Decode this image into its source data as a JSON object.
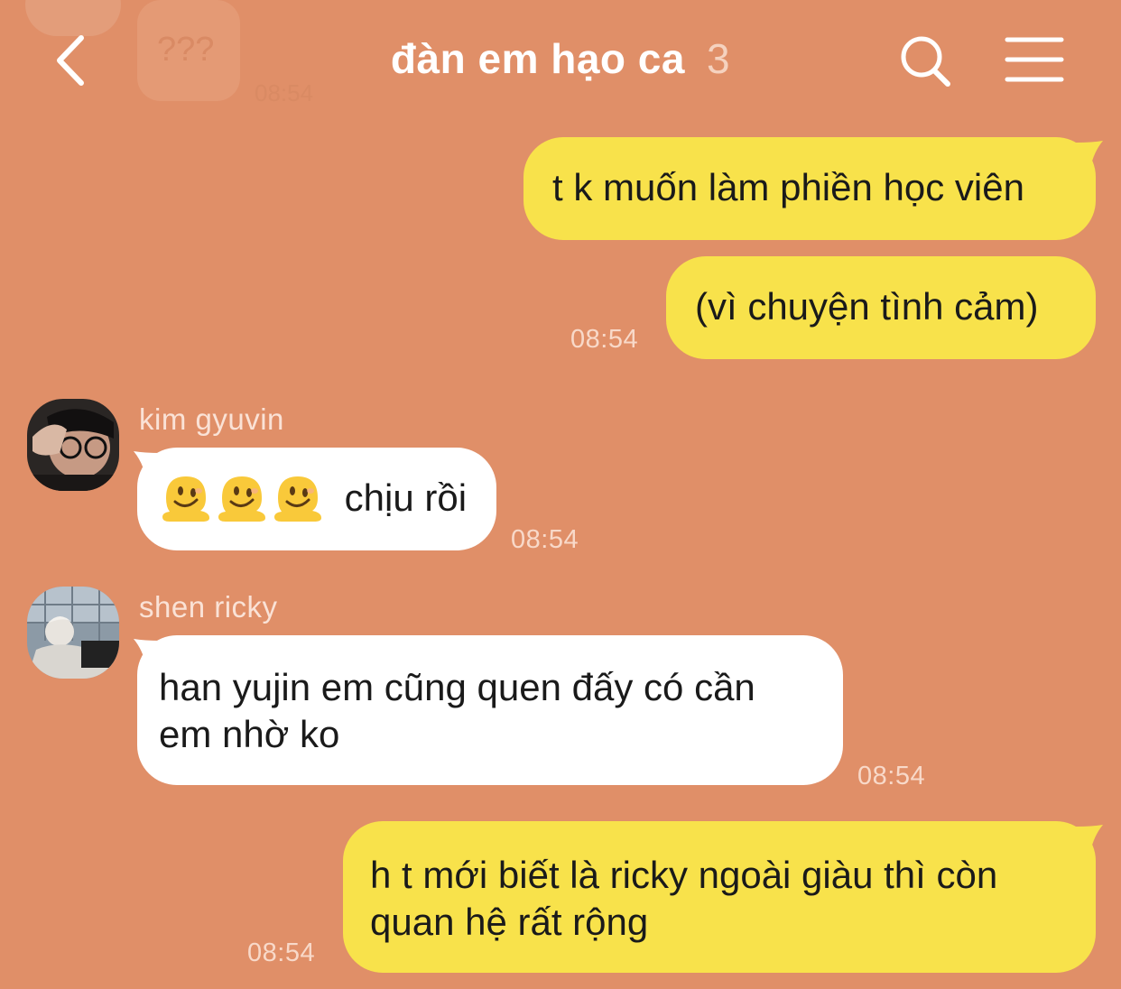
{
  "header": {
    "title": "đàn em hạo ca",
    "member_count": "3",
    "ghost_bubble_text": "???",
    "ghost_time": "08:54"
  },
  "icons": {
    "back": "chevron-left-icon",
    "search": "search-icon",
    "menu": "hamburger-menu-icon",
    "emoji": "melting-face-emoji"
  },
  "colors": {
    "background": "#e08f68",
    "my_bubble": "#f8e24b",
    "their_bubble": "#ffffff"
  },
  "messages": [
    {
      "id": "m1",
      "sender": "me",
      "text": "t k muốn làm phiền học viên"
    },
    {
      "id": "m2",
      "sender": "me",
      "text": "(vì chuyện tình cảm)",
      "time": "08:54"
    },
    {
      "id": "m3",
      "sender": "kim gyuvin",
      "emoji_count": 3,
      "text": "chịu rồi",
      "time": "08:54"
    },
    {
      "id": "m4",
      "sender": "shen ricky",
      "text_lines": [
        "han yujin em cũng quen đấy có cần",
        "em nhờ ko"
      ],
      "time": "08:54"
    },
    {
      "id": "m5",
      "sender": "me",
      "text_lines": [
        "h t mới biết là ricky ngoài giàu thì còn",
        "quan hệ rất rộng"
      ],
      "time": "08:54"
    }
  ]
}
